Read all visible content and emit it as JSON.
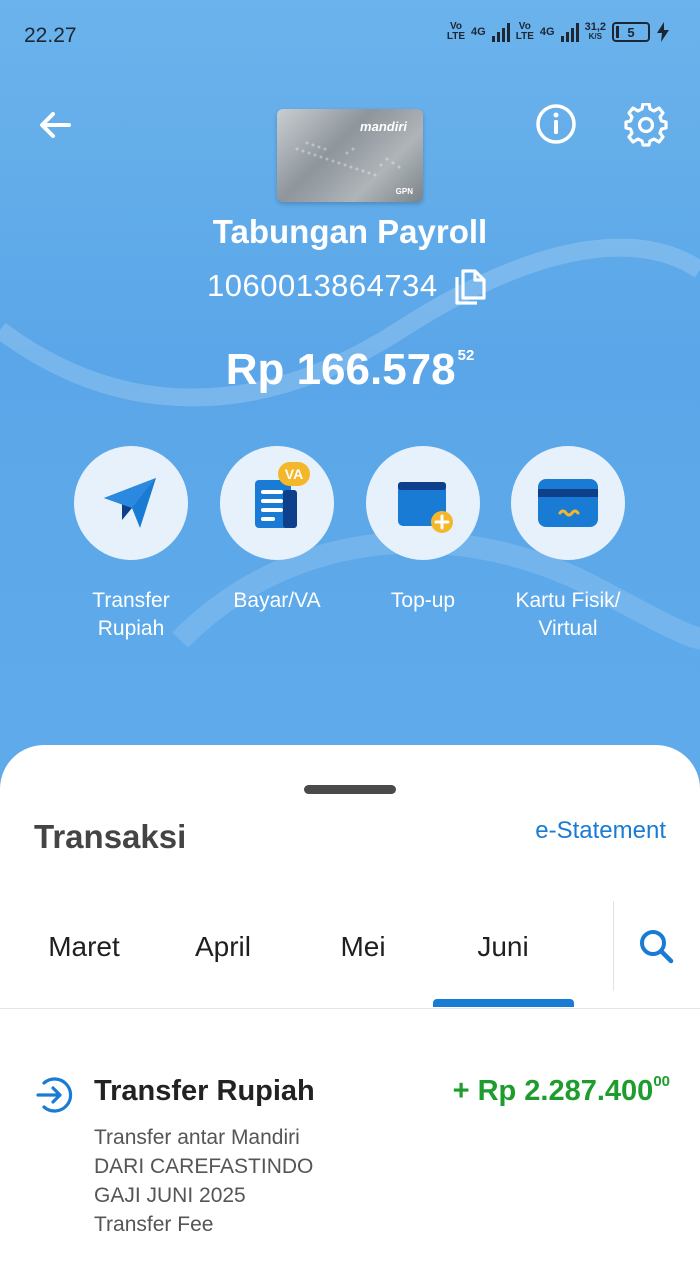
{
  "status_bar": {
    "time": "22.27",
    "volte_1_top": "Vo",
    "volte_1_bottom": "LTE",
    "net_1": "4G",
    "volte_2_top": "Vo",
    "volte_2_bottom": "LTE",
    "net_2": "4G",
    "speed_value": "31,2",
    "speed_unit": "K/S",
    "battery": "5"
  },
  "header": {
    "card_brand": "mandiri",
    "card_network": "GPN",
    "account_name": "Tabungan Payroll",
    "account_number": "1060013864734",
    "balance_main": "Rp 166.578",
    "balance_cents": "52"
  },
  "actions": [
    {
      "label_line1": "Transfer",
      "label_line2": "Rupiah",
      "icon": "paper-plane-icon"
    },
    {
      "label_line1": "Bayar/VA",
      "label_line2": "",
      "icon": "bill-va-icon",
      "badge": "VA"
    },
    {
      "label_line1": "Top-up",
      "label_line2": "",
      "icon": "wallet-topup-icon"
    },
    {
      "label_line1": "Kartu Fisik/",
      "label_line2": "Virtual",
      "icon": "card-icon"
    }
  ],
  "transactions": {
    "title": "Transaksi",
    "estatement_label": "e-Statement",
    "tabs": [
      "Maret",
      "April",
      "Mei",
      "Juni"
    ],
    "selected_tab": "Juni",
    "items": [
      {
        "title": "Transfer Rupiah",
        "amount_main": "+ Rp 2.287.400",
        "amount_cents": "00",
        "desc_1": "Transfer antar Mandiri",
        "desc_2": "DARI CAREFASTINDO",
        "desc_3": "GAJI JUNI 2025",
        "desc_4": "Transfer Fee"
      }
    ]
  },
  "colors": {
    "header_blue": "#5aa6e8",
    "accent_blue": "#1a7bd5",
    "credit_green": "#1e9c2e",
    "badge_yellow": "#f5b72a"
  }
}
